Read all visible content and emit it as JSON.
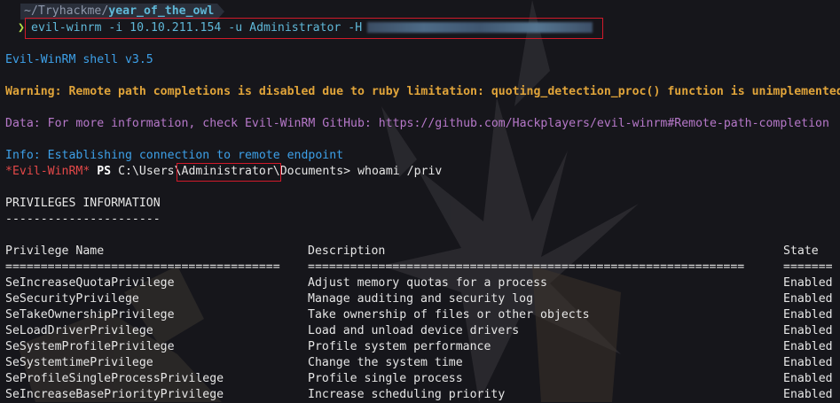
{
  "prompt": {
    "path_prefix": "~/Tryhackme/",
    "path_current": "year_of_the_owl",
    "caret": "❯",
    "command": "evil-winrm -i 10.10.211.154 -u Administrator -H"
  },
  "output": {
    "banner": "Evil-WinRM shell v3.5",
    "warning": "Warning: Remote path completions is disabled due to ruby limitation: quoting_detection_proc() function is unimplemented",
    "data_line": "Data: For more information, check Evil-WinRM GitHub: https://github.com/Hackplayers/evil-winrm#Remote-path-completion",
    "info": "Info: Establishing connection to remote endpoint",
    "ps_prompt_tag": "*Evil-WinRM*",
    "ps_label": "PS",
    "ps_path_a": "C:\\Users",
    "ps_path_b": "\\Administrator\\",
    "ps_path_c": "Documents>",
    "ps_command": "whoami /priv",
    "priv_heading": "PRIVILEGES INFORMATION",
    "priv_heading_rule": "----------------------",
    "table": {
      "headers": [
        "Privilege Name",
        "Description",
        "State"
      ],
      "rules": [
        "=======================================",
        "==============================================================",
        "======="
      ],
      "rows": [
        [
          "SeIncreaseQuotaPrivilege",
          "Adjust memory quotas for a process",
          "Enabled"
        ],
        [
          "SeSecurityPrivilege",
          "Manage auditing and security log",
          "Enabled"
        ],
        [
          "SeTakeOwnershipPrivilege",
          "Take ownership of files or other objects",
          "Enabled"
        ],
        [
          "SeLoadDriverPrivilege",
          "Load and unload device drivers",
          "Enabled"
        ],
        [
          "SeSystemProfilePrivilege",
          "Profile system performance",
          "Enabled"
        ],
        [
          "SeSystemtimePrivilege",
          "Change the system time",
          "Enabled"
        ],
        [
          "SeProfileSingleProcessPrivilege",
          "Profile single process",
          "Enabled"
        ],
        [
          "SeIncreaseBasePriorityPrivilege",
          "Increase scheduling priority",
          "Enabled"
        ]
      ]
    }
  },
  "colors": {
    "background": "#16161b",
    "highlight_box": "#d11a2a",
    "command": "#5fb8d8",
    "warning": "#e0a43a",
    "data": "#b678c9",
    "info": "#3da0e8"
  }
}
